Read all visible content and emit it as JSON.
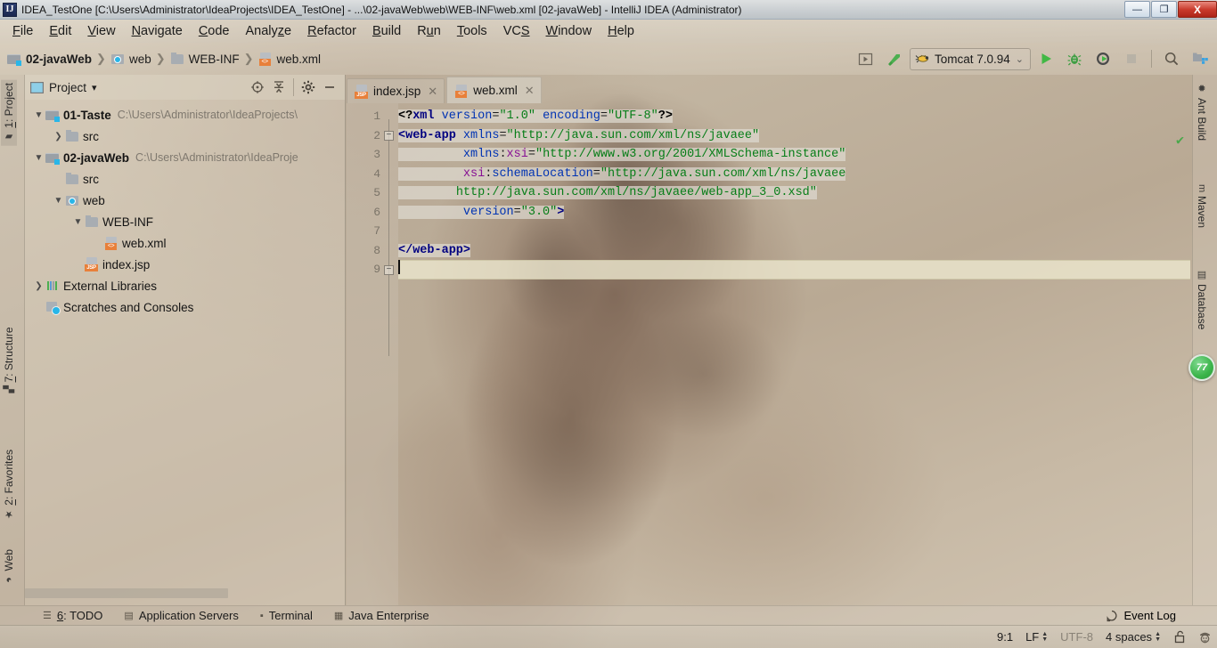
{
  "window": {
    "title": "IDEA_TestOne [C:\\Users\\Administrator\\IdeaProjects\\IDEA_TestOne] - ...\\02-javaWeb\\web\\WEB-INF\\web.xml [02-javaWeb] - IntelliJ IDEA (Administrator)",
    "app_icon": "IJ",
    "minimize": "—",
    "maximize": "❐",
    "close": "X"
  },
  "menubar": {
    "items": [
      {
        "label": "File",
        "mnemonic": "F"
      },
      {
        "label": "Edit",
        "mnemonic": "E"
      },
      {
        "label": "View",
        "mnemonic": "V"
      },
      {
        "label": "Navigate",
        "mnemonic": "N"
      },
      {
        "label": "Code",
        "mnemonic": "C"
      },
      {
        "label": "Analyze",
        "mnemonic": "z"
      },
      {
        "label": "Refactor",
        "mnemonic": "R"
      },
      {
        "label": "Build",
        "mnemonic": "B"
      },
      {
        "label": "Run",
        "mnemonic": "u"
      },
      {
        "label": "Tools",
        "mnemonic": "T"
      },
      {
        "label": "VCS",
        "mnemonic": "S"
      },
      {
        "label": "Window",
        "mnemonic": "W"
      },
      {
        "label": "Help",
        "mnemonic": "H"
      }
    ]
  },
  "breadcrumb": {
    "items": [
      {
        "label": "02-javaWeb",
        "icon": "module-icon",
        "bold": true
      },
      {
        "label": "web",
        "icon": "web-folder-icon",
        "bold": false
      },
      {
        "label": "WEB-INF",
        "icon": "folder-icon",
        "bold": false
      },
      {
        "label": "web.xml",
        "icon": "xml-file-icon",
        "bold": false
      }
    ],
    "separator": "❯"
  },
  "toolbar": {
    "run_config": {
      "label": "Tomcat 7.0.94",
      "icon": "tomcat-icon",
      "chevron": "⌄"
    },
    "buttons": [
      {
        "name": "run-dashboard-button",
        "glyph": "▶"
      },
      {
        "name": "build-hammer-button",
        "glyph": "⌃"
      },
      {
        "name": "run-button",
        "glyph": "▶"
      },
      {
        "name": "debug-button",
        "glyph": "🐞"
      },
      {
        "name": "run-with-coverage-button",
        "glyph": "◗"
      },
      {
        "name": "stop-button",
        "glyph": "■"
      },
      {
        "name": "search-everywhere-button",
        "glyph": "⌕"
      },
      {
        "name": "project-structure-button",
        "glyph": "▦"
      }
    ]
  },
  "left_stripe": {
    "tabs": [
      {
        "label": "1: Project",
        "mnemonic": "1",
        "icon": "project-icon",
        "active": true
      },
      {
        "label": "7: Structure",
        "mnemonic": "7",
        "icon": "structure-icon",
        "active": false
      },
      {
        "label": "2: Favorites",
        "mnemonic": "2",
        "icon": "star-icon",
        "active": false
      },
      {
        "label": "Web",
        "mnemonic": "",
        "icon": "web-icon",
        "active": false
      }
    ]
  },
  "right_stripe": {
    "tabs": [
      {
        "label": "Ant Build",
        "icon": "ant-icon"
      },
      {
        "label": "Maven",
        "icon": "maven-icon"
      },
      {
        "label": "Database",
        "icon": "database-icon"
      }
    ],
    "badge": "77"
  },
  "project_panel": {
    "title": "Project",
    "title_chevron": "▾",
    "actions": [
      {
        "name": "select-opened-file-button",
        "glyph": "⊕"
      },
      {
        "name": "collapse-all-button",
        "glyph": "⇟"
      },
      {
        "name": "settings-gear-button",
        "glyph": "⚙"
      },
      {
        "name": "hide-panel-button",
        "glyph": "—"
      }
    ],
    "tree": [
      {
        "label": "01-Taste",
        "path": "C:\\Users\\Administrator\\IdeaProjects\\",
        "icon": "module-icon",
        "indent": 0,
        "arrow": "expanded",
        "bold": true
      },
      {
        "label": "src",
        "path": "",
        "icon": "folder-icon",
        "indent": 1,
        "arrow": "collapsed",
        "bold": false
      },
      {
        "label": "02-javaWeb",
        "path": "C:\\Users\\Administrator\\IdeaProje",
        "icon": "module-icon",
        "indent": 0,
        "arrow": "expanded",
        "bold": true
      },
      {
        "label": "src",
        "path": "",
        "icon": "folder-icon",
        "indent": 1,
        "arrow": "none",
        "bold": false
      },
      {
        "label": "web",
        "path": "",
        "icon": "web-folder-icon",
        "indent": 1,
        "arrow": "expanded",
        "bold": false
      },
      {
        "label": "WEB-INF",
        "path": "",
        "icon": "folder-grey-icon",
        "indent": 2,
        "arrow": "expanded",
        "bold": false
      },
      {
        "label": "web.xml",
        "path": "",
        "icon": "xml-file-icon",
        "indent": 3,
        "arrow": "none",
        "bold": false
      },
      {
        "label": "index.jsp",
        "path": "",
        "icon": "jsp-file-icon",
        "indent": 2,
        "arrow": "none",
        "bold": false
      },
      {
        "label": "External Libraries",
        "path": "",
        "icon": "libraries-icon",
        "indent": 0,
        "arrow": "collapsed",
        "bold": false
      },
      {
        "label": "Scratches and Consoles",
        "path": "",
        "icon": "scratches-icon",
        "indent": 0,
        "arrow": "none",
        "bold": false
      }
    ]
  },
  "editor": {
    "tabs": [
      {
        "label": "index.jsp",
        "icon": "jsp-file-icon",
        "active": false,
        "close": "✕"
      },
      {
        "label": "web.xml",
        "icon": "xml-file-icon",
        "active": true,
        "close": "✕"
      }
    ],
    "line_numbers": [
      "1",
      "2",
      "3",
      "4",
      "5",
      "6",
      "7",
      "8",
      "9"
    ],
    "fold_markers": [
      {
        "line": 2,
        "glyph": "−"
      },
      {
        "line": 8,
        "glyph": "−"
      }
    ],
    "inspection_status": "✔",
    "current_line": 9,
    "lines": [
      {
        "n": 1,
        "tokens": [
          {
            "t": "<?",
            "c": "pi"
          },
          {
            "t": "xml",
            "c": "tag"
          },
          {
            "t": " ",
            "c": "punct"
          },
          {
            "t": "version",
            "c": "attr"
          },
          {
            "t": "=",
            "c": "punct"
          },
          {
            "t": "\"1.0\"",
            "c": "val"
          },
          {
            "t": " ",
            "c": "punct"
          },
          {
            "t": "encoding",
            "c": "attr"
          },
          {
            "t": "=",
            "c": "punct"
          },
          {
            "t": "\"UTF-8\"",
            "c": "val"
          },
          {
            "t": "?>",
            "c": "pi"
          }
        ]
      },
      {
        "n": 2,
        "tokens": [
          {
            "t": "<web-app",
            "c": "tag"
          },
          {
            "t": " ",
            "c": "punct"
          },
          {
            "t": "xmlns",
            "c": "attr"
          },
          {
            "t": "=",
            "c": "punct"
          },
          {
            "t": "\"http://java.sun.com/xml/ns/javaee\"",
            "c": "val"
          }
        ]
      },
      {
        "n": 3,
        "tokens": [
          {
            "t": "         ",
            "c": "punct"
          },
          {
            "t": "xmlns",
            "c": "attr"
          },
          {
            "t": ":",
            "c": "punct"
          },
          {
            "t": "xsi",
            "c": "ns"
          },
          {
            "t": "=",
            "c": "punct"
          },
          {
            "t": "\"http://www.w3.org/2001/XMLSchema-instance\"",
            "c": "val"
          }
        ]
      },
      {
        "n": 4,
        "tokens": [
          {
            "t": "         ",
            "c": "punct"
          },
          {
            "t": "xsi",
            "c": "ns"
          },
          {
            "t": ":",
            "c": "punct"
          },
          {
            "t": "schemaLocation",
            "c": "attr"
          },
          {
            "t": "=",
            "c": "punct"
          },
          {
            "t": "\"http://java.sun.com/xml/ns/javaee",
            "c": "val"
          }
        ]
      },
      {
        "n": 5,
        "tokens": [
          {
            "t": "        ",
            "c": "punct"
          },
          {
            "t": "http://java.sun.com/xml/ns/javaee/web-app_3_0.xsd\"",
            "c": "val"
          }
        ]
      },
      {
        "n": 6,
        "tokens": [
          {
            "t": "         ",
            "c": "punct"
          },
          {
            "t": "version",
            "c": "attr"
          },
          {
            "t": "=",
            "c": "punct"
          },
          {
            "t": "\"3.0\"",
            "c": "val"
          },
          {
            "t": ">",
            "c": "tag"
          }
        ]
      },
      {
        "n": 7,
        "tokens": []
      },
      {
        "n": 8,
        "tokens": [
          {
            "t": "</web-app>",
            "c": "tag"
          }
        ]
      },
      {
        "n": 9,
        "tokens": []
      }
    ]
  },
  "bottom_bar": {
    "tabs": [
      {
        "label": "6: TODO",
        "mnemonic": "6",
        "icon": "todo-icon"
      },
      {
        "label": "Application Servers",
        "mnemonic": "",
        "icon": "app-servers-icon"
      },
      {
        "label": "Terminal",
        "mnemonic": "",
        "icon": "terminal-icon"
      },
      {
        "label": "Java Enterprise",
        "mnemonic": "",
        "icon": "java-enterprise-icon"
      }
    ],
    "event_log": {
      "label": "Event Log",
      "icon": "event-log-icon"
    }
  },
  "status_bar": {
    "caret_position": "9:1",
    "line_separator": "LF",
    "encoding": "UTF-8",
    "indent": "4 spaces",
    "lock_icon": "unlocked-icon",
    "inspection_icon": "inspection-face-icon"
  },
  "colors": {
    "accent_green": "#3bb44a",
    "xml_tag": "#000080",
    "xml_attr": "#0033b3",
    "xml_value": "#067d17",
    "xml_ns": "#871094",
    "file_orange": "#e8803a",
    "folder_blue": "#8ecfe8"
  }
}
